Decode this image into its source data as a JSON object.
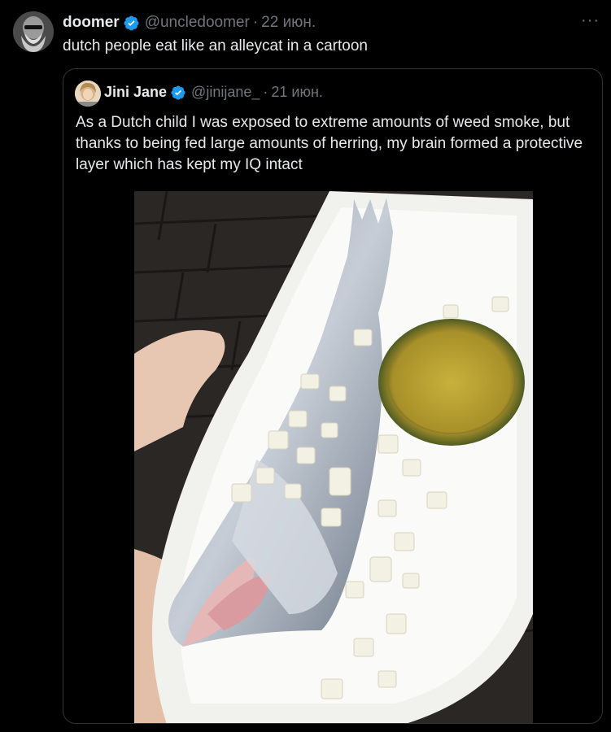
{
  "tweet": {
    "author_name": "doomer",
    "author_handle": "@uncledoomer",
    "date": "22 июн.",
    "text": "dutch people eat like an alleycat in a cartoon",
    "more_label": "···"
  },
  "quote": {
    "author_name": "Jini Jane",
    "author_handle": "@jinijane_",
    "date": "21 июн.",
    "text": "As a Dutch child I was exposed to extreme amounts of weed smoke, but thanks to being fed large amounts of herring, my brain formed a protective layer which has kept my IQ intact"
  },
  "colors": {
    "background": "#000000",
    "text": "#e7e9ea",
    "muted": "#71767b",
    "verified": "#1d9bf0",
    "border": "#2f3336"
  },
  "icons": [
    "verified-badge-icon",
    "more-options-icon"
  ]
}
